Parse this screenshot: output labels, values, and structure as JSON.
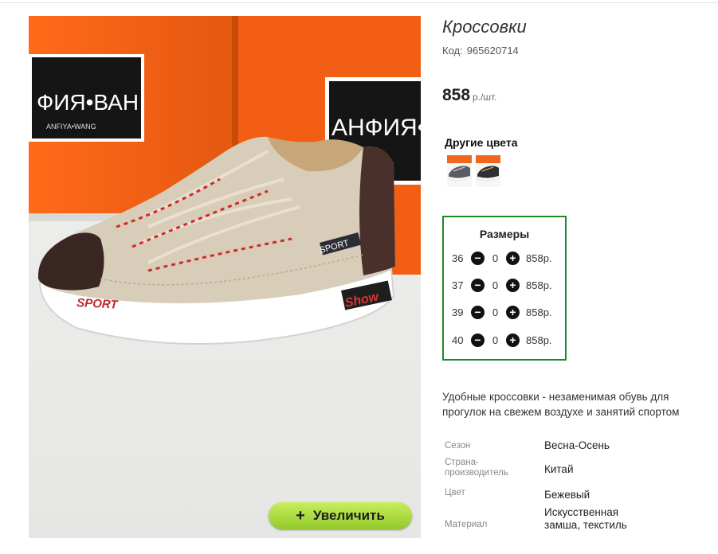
{
  "product": {
    "title": "Кроссовки",
    "code_label": "Код:",
    "code": "965620714",
    "price": "858",
    "price_unit": "р./шт."
  },
  "photo": {
    "box_brand": "АНФИЯ•ВАН",
    "box_brand_partial": "ФИЯ•ВАН",
    "box_brand_latin": "ANFIYA•WANG",
    "tongue_label": "SPORT",
    "side_label": "SPORT",
    "heel_label": "Show"
  },
  "zoom_button": {
    "icon": "+",
    "label": "Увеличить"
  },
  "other_colors": {
    "title": "Другие цвета",
    "swatch_colors": [
      "#5a5d66",
      "#2f2f35"
    ]
  },
  "sizes": {
    "title": "Размеры",
    "items": [
      {
        "size": "36",
        "qty": "0",
        "price": "858р."
      },
      {
        "size": "37",
        "qty": "0",
        "price": "858р."
      },
      {
        "size": "39",
        "qty": "0",
        "price": "858р."
      },
      {
        "size": "40",
        "qty": "0",
        "price": "858р."
      }
    ],
    "border_color": "#1d8a26"
  },
  "description": "Удобные кроссовки - незаменимая обувь для прогулок на свежем воздухе и занятий спортом",
  "specs": [
    {
      "label": "Сезон",
      "value": "Весна-Осень"
    },
    {
      "label": "Страна-производитель",
      "value": "Китай"
    },
    {
      "label": "Цвет",
      "value": "Бежевый"
    },
    {
      "label": "Материал",
      "value": "Искусственная замша, текстиль"
    }
  ]
}
